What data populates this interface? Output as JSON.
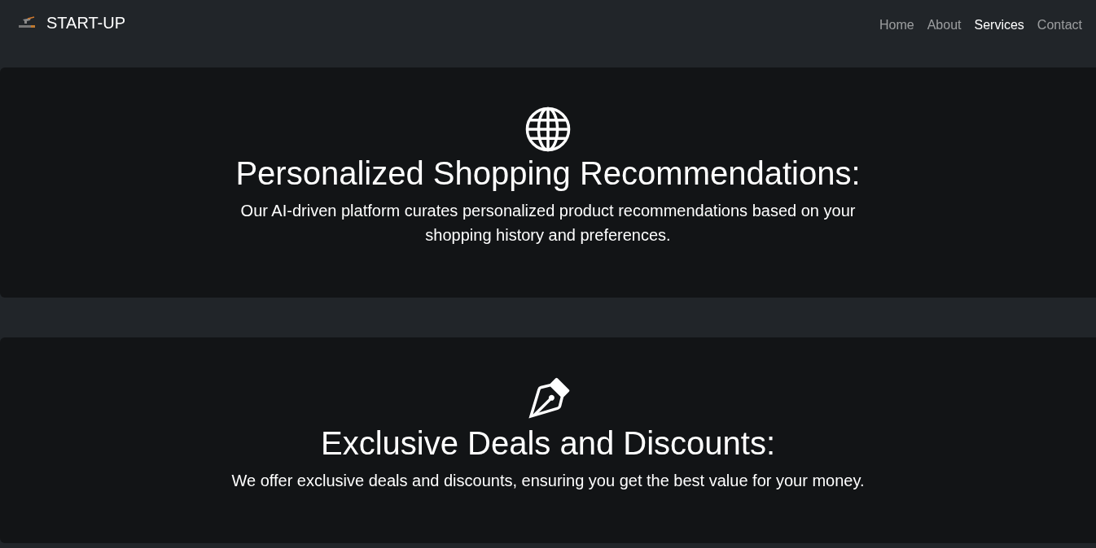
{
  "navbar": {
    "brand": "START-UP",
    "links": [
      {
        "label": "Home",
        "selected": false
      },
      {
        "label": "About",
        "selected": false
      },
      {
        "label": "Services",
        "selected": true
      },
      {
        "label": "Contact",
        "selected": false
      }
    ]
  },
  "services": [
    {
      "kind": "globe",
      "title": "Personalized Shopping Recommendations:",
      "description": "Our AI-driven platform curates personalized product recommendations based on your shopping history and preferences."
    },
    {
      "kind": "pen",
      "title": "Exclusive Deals and Discounts:",
      "description": "We offer exclusive deals and discounts, ensuring you get the best value for your money."
    }
  ]
}
